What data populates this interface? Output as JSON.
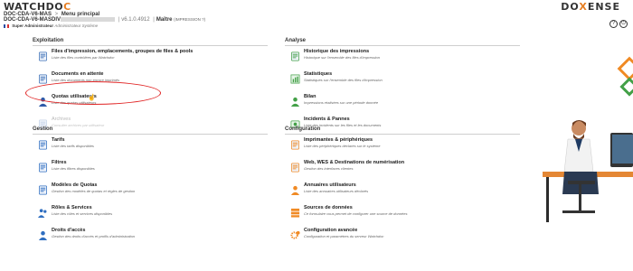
{
  "header": {
    "logo_prefix": "WATCHDO",
    "logo_accent": "C",
    "brand_prefix": "DO",
    "brand_accent": "X",
    "brand_suffix": "ENSE",
    "breadcrumb_server": "DOC-CDA-V6-MAS",
    "breadcrumb_separator": ">",
    "breadcrumb_page": "Menu principal",
    "instance_prefix": "DOC-CDA-V6-MASDIV",
    "version": "v6.1.0.4912",
    "mode_label": "Maître",
    "mode_detail": "(IMPRESSION ?)",
    "user_name": "Super Administrateur",
    "user_role": "Administrateur Système"
  },
  "exploitation": {
    "title": "Exploitation",
    "items": [
      {
        "title": "Files d'impression, emplacements, groupes de files & pools",
        "desc": "Liste des files contrôlées par Watchdoc",
        "icon": "printer-queue-icon",
        "color": "#3b6fb6"
      },
      {
        "title": "Documents en attente",
        "desc": "Liste des documents non encore imprimés",
        "icon": "pending-documents-icon",
        "color": "#3b6fb6"
      },
      {
        "title": "Quotas utilisateurs",
        "desc": "Liste des quotas utilisateurs",
        "icon": "user-quota-icon",
        "color": "#2f5aa8"
      },
      {
        "title": "Archives",
        "desc": "Consulter archives par utilisateur",
        "icon": "archives-icon",
        "color": "#c9d6ea",
        "disabled": true
      }
    ]
  },
  "gestion": {
    "title": "Gestion",
    "items": [
      {
        "title": "Tarifs",
        "desc": "Liste des tarifs disponibles",
        "icon": "pricing-icon",
        "color": "#2f6ec0"
      },
      {
        "title": "Filtres",
        "desc": "Liste des filtres disponibles",
        "icon": "filters-icon",
        "color": "#2f6ec0"
      },
      {
        "title": "Modèles de Quotas",
        "desc": "Gestion des modèles de quotas et règles de gestion",
        "icon": "quota-models-icon",
        "color": "#2f6ec0"
      },
      {
        "title": "Rôles & Services",
        "desc": "Liste des rôles et services disponibles",
        "icon": "roles-services-icon",
        "color": "#2f6ec0"
      },
      {
        "title": "Droits d'accès",
        "desc": "Gestion des droits d'accès et profils d'administration",
        "icon": "access-rights-icon",
        "color": "#2f6ec0"
      }
    ]
  },
  "analyse": {
    "title": "Analyse",
    "items": [
      {
        "title": "Historique des impressions",
        "desc": "Historique sur l'ensemble des files d'impression",
        "icon": "print-history-icon",
        "color": "#43a047"
      },
      {
        "title": "Statistiques",
        "desc": "Statistiques sur l'ensemble des files d'impression",
        "icon": "statistics-icon",
        "color": "#43a047"
      },
      {
        "title": "Bilan",
        "desc": "Impressions réalisées sur une période donnée",
        "icon": "balance-icon",
        "color": "#43a047"
      },
      {
        "title": "Incidents & Pannes",
        "desc": "Liste des incidents sur les files et les documents",
        "icon": "incidents-icon",
        "color": "#43a047"
      }
    ]
  },
  "configuration": {
    "title": "Configuration",
    "items": [
      {
        "title": "Imprimantes & périphériques",
        "desc": "Liste des périphériques déclarés sur le système",
        "icon": "printers-devices-icon",
        "color": "#f08a24"
      },
      {
        "title": "Web, WES & Destinations de numérisation",
        "desc": "Gestion des interfaces clientes",
        "icon": "web-wes-icon",
        "color": "#f08a24"
      },
      {
        "title": "Annuaires utilisateurs",
        "desc": "Liste des annuaires utilisateurs déclarés",
        "icon": "user-directories-icon",
        "color": "#f08a24"
      },
      {
        "title": "Sources de données",
        "desc": "Ce formulaire vous permet de configurer une source de données",
        "icon": "data-sources-icon",
        "color": "#f08a24"
      },
      {
        "title": "Configuration avancée",
        "desc": "Configuration et paramètres du serveur Watchdoc",
        "icon": "advanced-config-icon",
        "color": "#f08a24"
      }
    ]
  }
}
